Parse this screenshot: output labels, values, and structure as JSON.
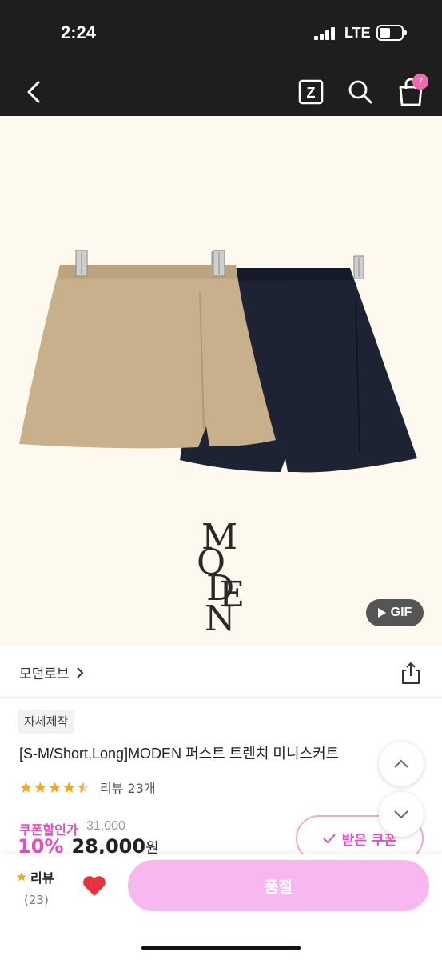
{
  "status_bar": {
    "time": "2:24",
    "network": "LTE"
  },
  "nav": {
    "back_icon": "chevron-left-icon",
    "z_icon": "z-logo-icon",
    "z_label": "Z",
    "search_icon": "search-icon",
    "cart_icon": "shopping-bag-icon",
    "cart_count": "7"
  },
  "hero": {
    "image_description": "two mini skirts, beige and navy, on hangers",
    "logo_letters": [
      "M",
      "O",
      "D",
      "E",
      "N"
    ],
    "gif_badge": "GIF",
    "gif_icon": "play-icon"
  },
  "brand": {
    "name": "모던로브",
    "share_icon": "share-icon"
  },
  "product": {
    "tag": "자체제작",
    "title": "[S-M/Short,Long]MODEN 퍼스트 트렌치 미니스커트",
    "rating": 4.5,
    "review_link": "리뷰 23개",
    "coupon_label": "쿠폰할인가",
    "original_price": "31,000",
    "discount": "10%",
    "price": "28,000",
    "price_unit": "원",
    "coupon_button": "받은 쿠폰"
  },
  "colors": {
    "accent_pink": "#e84cbd",
    "star": "#f5a623",
    "buy_button": "#f7b8ef",
    "heart": "#e8323c"
  },
  "bottom_bar": {
    "review_label": "리뷰",
    "review_count": "(23)",
    "buy_label": "품절"
  }
}
